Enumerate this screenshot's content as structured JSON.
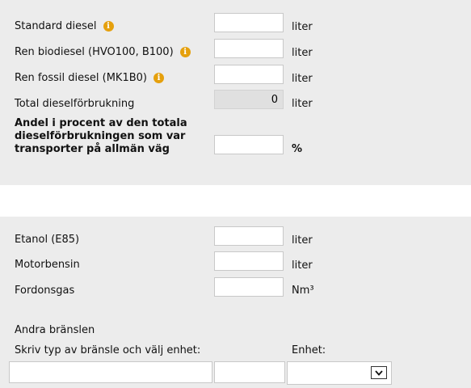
{
  "diesel": {
    "rows": [
      {
        "label": "Standard diesel",
        "value": "",
        "unit": "liter"
      },
      {
        "label": "Ren biodiesel (HVO100, B100)",
        "value": "",
        "unit": "liter"
      },
      {
        "label": "Ren fossil diesel (MK1B0)",
        "value": "",
        "unit": "liter"
      },
      {
        "label": "Total dieselförbrukning",
        "value": "0",
        "unit": "liter"
      }
    ],
    "share": {
      "label": "Andel i procent av den totala dieselförbrukningen som var transporter på allmän väg",
      "value": "",
      "unit": "%"
    },
    "info_glyph": "i"
  },
  "other": {
    "rows": [
      {
        "label": "Etanol (E85)",
        "value": "",
        "unit": "liter"
      },
      {
        "label": "Motorbensin",
        "value": "",
        "unit": "liter"
      },
      {
        "label": "Fordonsgas",
        "value": "",
        "unit": "Nm³"
      }
    ],
    "andra_heading": "Andra bränslen",
    "andra_instruction": "Skriv typ av bränsle och välj enhet:",
    "enhet_label": "Enhet:",
    "custom_fuel_value": "",
    "custom_amount_value": "",
    "unit_select_value": ""
  },
  "icons": {
    "info": "info-icon",
    "dropdown": "chevron-down-icon"
  },
  "colors": {
    "panel": "#ececec",
    "info": "#e5a00d",
    "readonly": "#e0e0e0"
  }
}
